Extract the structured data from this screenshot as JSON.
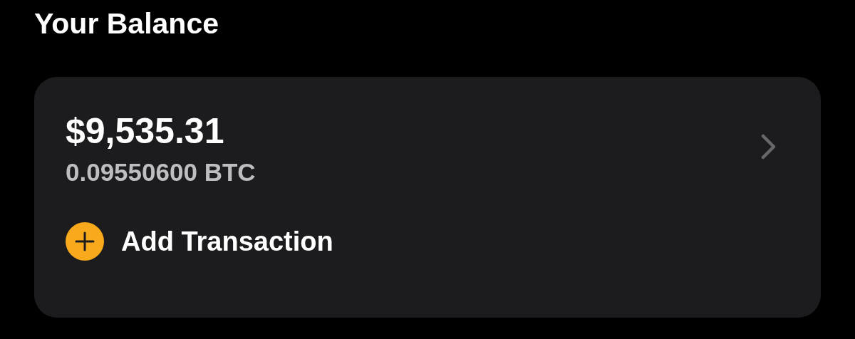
{
  "title": "Your Balance",
  "balance": {
    "fiat": "$9,535.31",
    "crypto": "0.09550600 BTC"
  },
  "action": {
    "label": "Add Transaction"
  }
}
